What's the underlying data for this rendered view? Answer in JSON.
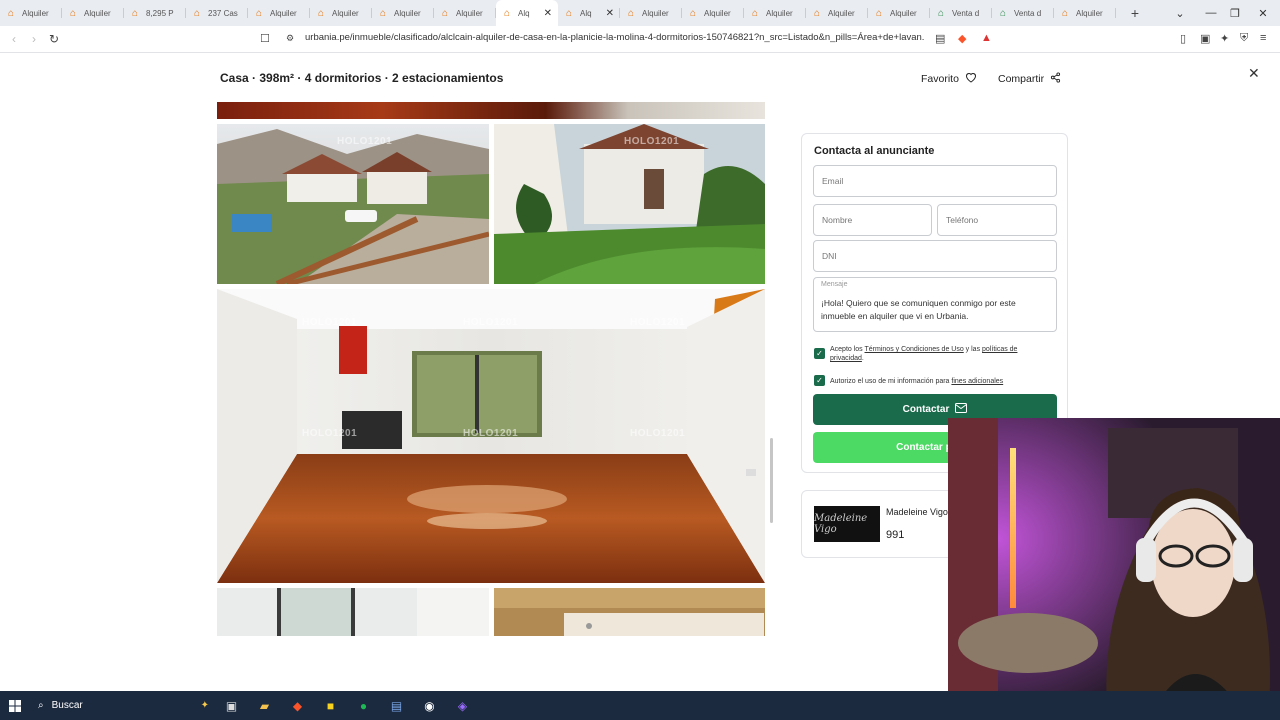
{
  "browser": {
    "tabs": [
      {
        "label": "Alquiler",
        "active": false
      },
      {
        "label": "Alquiler",
        "active": false
      },
      {
        "label": "8,295 P",
        "active": false
      },
      {
        "label": "237 Cas",
        "active": false
      },
      {
        "label": "Alquiler",
        "active": false
      },
      {
        "label": "Alquiler",
        "active": false
      },
      {
        "label": "Alquiler",
        "active": false
      },
      {
        "label": "Alquiler",
        "active": false
      },
      {
        "label": "Alq",
        "active": true
      },
      {
        "label": "Alq",
        "active": false
      },
      {
        "label": "Alquiler",
        "active": false
      },
      {
        "label": "Alquiler",
        "active": false
      },
      {
        "label": "Alquiler",
        "active": false
      },
      {
        "label": "Alquiler",
        "active": false
      },
      {
        "label": "Alquiler",
        "active": false
      },
      {
        "label": "Venta d",
        "active": false
      },
      {
        "label": "Venta d",
        "active": false
      },
      {
        "label": "Alquiler",
        "active": false
      }
    ],
    "url": "urbania.pe/inmueble/clasificado/alclcain-alquiler-de-casa-en-la-planicie-la-molina-4-dormitorios-150746821?n_src=Listado&n_pills=Área+de+lavan..."
  },
  "listing": {
    "title": "Casa · 398m² · 4 dormitorios · 2 estacionamientos",
    "favorite_label": "Favorito",
    "share_label": "Compartir",
    "watermark": "HOLO1201"
  },
  "contact_form": {
    "title": "Contacta al anunciante",
    "email_placeholder": "Email",
    "name_placeholder": "Nombre",
    "phone_placeholder": "Teléfono",
    "dni_placeholder": "DNI",
    "message_label": "Mensaje",
    "message_text": "¡Hola! Quiero que se comuniquen conmigo por este inmueble en alquiler que vi en Urbania.",
    "terms_prefix": "Acepto los ",
    "terms_link": "Términos y Condiciones de Uso",
    "terms_mid": " y las ",
    "privacy_link": "políticas de privacidad",
    "terms_suffix": ".",
    "consent_prefix": "Autorizo el uso de mi información para ",
    "consent_link": "fines adicionales",
    "contact_button": "Contactar",
    "whatsapp_button": "Contactar por W"
  },
  "agent": {
    "logo_text": "Madeleine Vigo",
    "name": "Madeleine Vigo",
    "phone": "991"
  },
  "taskbar": {
    "search_label": "Buscar"
  }
}
